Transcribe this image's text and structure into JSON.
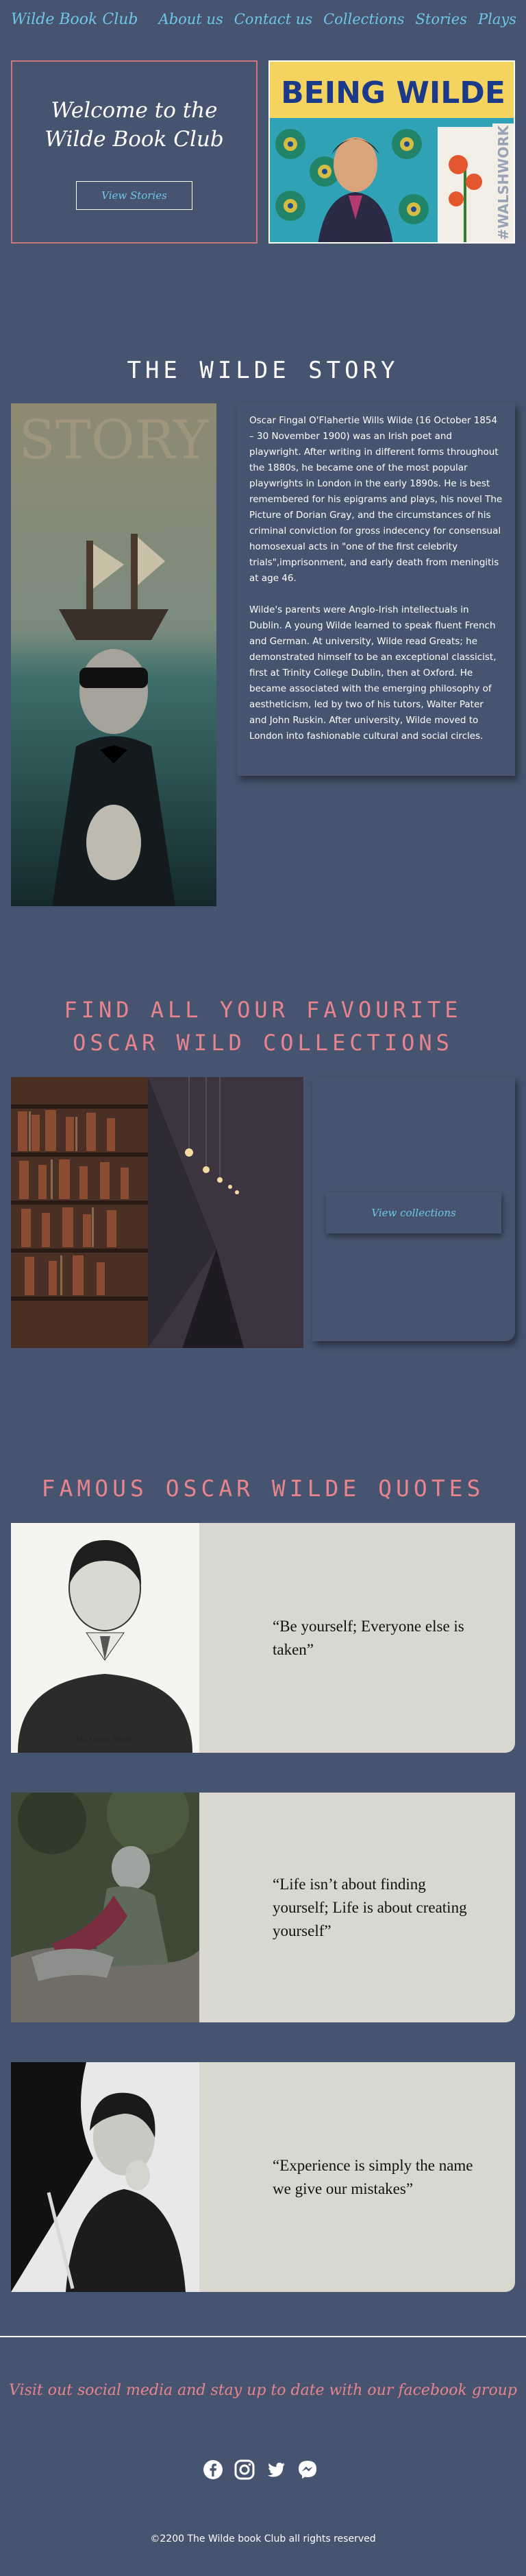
{
  "nav": {
    "brand": "Wilde Book Club",
    "links": [
      "About us",
      "Contact us",
      "Collections",
      "Stories",
      "Plays"
    ]
  },
  "hero": {
    "title_line1": "Welcome to the",
    "title_line2": "Wilde Book Club",
    "button": "View Stories",
    "poster_title": "BEING WILDE",
    "poster_tag": "#WALSHWORK"
  },
  "story": {
    "heading": "THE WILDE STORY",
    "image_text": "STORY",
    "paragraph1": "Oscar Fingal O'Flahertie Wills Wilde (16 October 1854 – 30 November 1900) was an Irish poet and playwright. After writing in different forms throughout the 1880s, he became one of the most popular playwrights in London in the early 1890s. He is best remembered for his epigrams and plays, his novel The Picture of Dorian Gray, and the circumstances of his criminal conviction for gross indecency for consensual homosexual acts in \"one of the first celebrity trials\",imprisonment, and early death from meningitis at age 46.",
    "paragraph2": "Wilde's parents were Anglo-Irish intellectuals in Dublin. A young Wilde learned to speak fluent French and German. At university, Wilde read Greats; he demonstrated himself to be an exceptional classicist, first at Trinity College Dublin, then at Oxford. He became associated with the emerging philosophy of aestheticism, led by two of his tutors, Walter Pater and John Ruskin. After university, Wilde moved to London into fashionable cultural and social circles."
  },
  "collections": {
    "heading": "FIND ALL YOUR FAVOURITE OSCAR WILD COLLECTIONS",
    "button": "View collections"
  },
  "quotes": {
    "heading": "FAMOUS OSCAR WILDE QUOTES",
    "caption1": "Mr. Oscar Wilde.",
    "items": [
      "“Be yourself; Everyone else is taken”",
      "“Life isn’t about finding yourself; Life is about creating yourself”",
      "“Experience is simply the name we give our mistakes”"
    ]
  },
  "footer": {
    "social_cta": "Visit out social media and stay up to date with our facebook group",
    "social_icons": [
      "facebook-icon",
      "instagram-icon",
      "twitter-icon",
      "messenger-icon"
    ],
    "copyright": "©2200 The Wilde book Club all rights reserved"
  },
  "colors": {
    "background": "#47546f",
    "accent_blue": "#6ec6ea",
    "accent_pink": "#e7848d",
    "quote_card": "#d8d8cf"
  }
}
